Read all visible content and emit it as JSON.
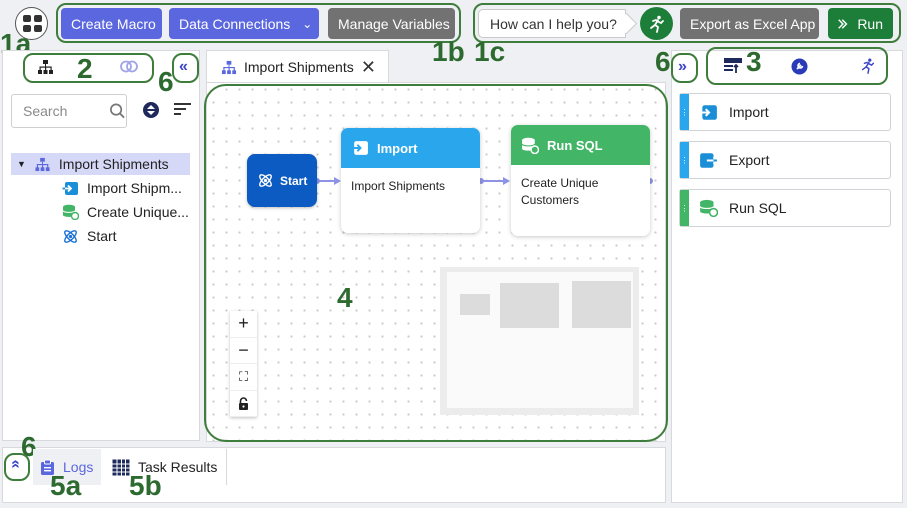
{
  "colors": {
    "accent": "#5b67de",
    "run_green": "#1d7e3a",
    "annotation_green": "#3f7d3c",
    "start_blue": "#0c5bc2",
    "import_blue": "#2aa7ec",
    "sql_green": "#43b567",
    "export_blue": "#1a8ed6"
  },
  "header": {
    "create_macro": "Create Macro",
    "data_connections": "Data Connections",
    "manage_variables": "Manage Variables",
    "help_prompt": "How can I help you?",
    "export_excel": "Export as Excel App",
    "run": "Run"
  },
  "annotations": {
    "a1a": "1a",
    "a1b": "1b",
    "a1c": "1c",
    "a2": "2",
    "a3": "3",
    "a4": "4",
    "a5a": "5a",
    "a5b": "5b",
    "a6": "6"
  },
  "sidebar": {
    "search_placeholder": "Search",
    "tree": [
      {
        "label": "Import Shipments",
        "icon": "hierarchy-icon",
        "selected": true
      },
      {
        "label": "Import Shipm...",
        "icon": "import-icon"
      },
      {
        "label": "Create Unique...",
        "icon": "run-sql-icon"
      },
      {
        "label": "Start",
        "icon": "start-atom-icon"
      }
    ]
  },
  "canvas": {
    "tab_title": "Import Shipments",
    "nodes": {
      "start": {
        "label": "Start"
      },
      "import": {
        "title": "Import",
        "body": "Import Shipments"
      },
      "sql": {
        "title": "Run SQL",
        "body_line1": "Create Unique",
        "body_line2": "Customers"
      }
    },
    "zoom_controls": [
      "+",
      "−",
      "⛶",
      "🔒"
    ]
  },
  "palette": {
    "items": [
      {
        "label": "Import",
        "icon": "import-icon"
      },
      {
        "label": "Export",
        "icon": "export-icon"
      },
      {
        "label": "Run SQL",
        "icon": "run-sql-icon"
      }
    ]
  },
  "bottom": {
    "tabs": [
      {
        "label": "Logs",
        "active": false
      },
      {
        "label": "Task Results",
        "active": true
      }
    ]
  }
}
